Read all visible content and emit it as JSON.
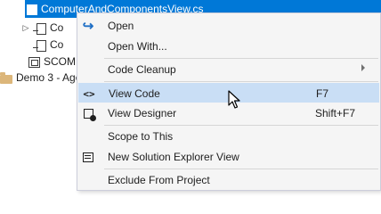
{
  "tree": {
    "selected_file": "ComputerAndComponentsView.cs",
    "child_1": "Co",
    "child_2": "Co",
    "scom": "SCOM...",
    "folder": "Demo 3 - Age"
  },
  "menu": {
    "items": [
      {
        "label": "Open",
        "icon": "open-arrow-icon",
        "shortcut": ""
      },
      {
        "label": "Open With...",
        "icon": "",
        "shortcut": ""
      },
      {
        "label": "Code Cleanup",
        "icon": "",
        "shortcut": "",
        "submenu": true
      },
      {
        "label": "View Code",
        "icon": "code-brackets-icon",
        "shortcut": "F7",
        "highlighted": true
      },
      {
        "label": "View Designer",
        "icon": "designer-icon",
        "shortcut": "Shift+F7"
      },
      {
        "label": "Scope to This",
        "icon": "",
        "shortcut": ""
      },
      {
        "label": "New Solution Explorer View",
        "icon": "new-view-icon",
        "shortcut": ""
      },
      {
        "label": "Exclude From Project",
        "icon": "",
        "shortcut": ""
      }
    ]
  },
  "colors": {
    "selection": "#0078d7",
    "menu_highlight": "#c9def5",
    "menu_background": "#f5f5f5"
  }
}
